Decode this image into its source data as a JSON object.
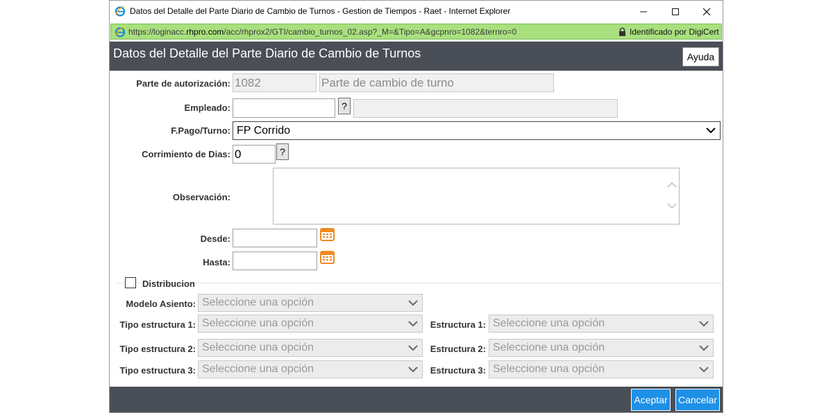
{
  "browser": {
    "window_title": "Datos del Detalle del Parte Diario de Cambio de Turnos - Gestion de Tiempos - Raet - Internet Explorer",
    "minimize_glyph": "—",
    "maximize_glyph": "☐",
    "close_glyph": "✕",
    "url_prefix": "https://loginacc.",
    "url_domain": "rhpro.com",
    "url_path": "/acc/rhprox2/GTI/cambio_turnos_02.asp?_M=&Tipo=A&gcpnro=1082&ternro=0",
    "security_text": "Identificado por DigiCert",
    "address_bar_color": "#a9e07f"
  },
  "header": {
    "title": "Datos del Detalle del Parte Diario de Cambio de Turnos",
    "help_label": "Ayuda",
    "background_color": "#4a4e57"
  },
  "form": {
    "parte_label": "Parte de autorización:",
    "parte_number": "1082",
    "parte_description": "Parte de cambio de turno",
    "empleado_label": "Empleado:",
    "empleado_value": "",
    "empleado_name": "",
    "help_glyph": "?",
    "fpago_label": "F.Pago/Turno:",
    "fpago_value": "FP Corrido",
    "corrimiento_label": "Corrimiento de Dias:",
    "corrimiento_value": "0",
    "observacion_label": "Observación:",
    "desde_label": "Desde:",
    "desde_value": "",
    "hasta_label": "Hasta:",
    "hasta_value": ""
  },
  "distribucion": {
    "checkbox_label": "Distribucion",
    "checked": false,
    "modelo_label": "Modelo Asiento:",
    "modelo_value": "Seleccione una opción",
    "tipo1_label": "Tipo estructura 1:",
    "tipo1_value": "Seleccione una opción",
    "estr1_label": "Estructura 1:",
    "estr1_value": "Seleccione una opción",
    "tipo2_label": "Tipo estructura 2:",
    "tipo2_value": "Seleccione una opción",
    "estr2_label": "Estructura 2:",
    "estr2_value": "Seleccione una opción",
    "tipo3_label": "Tipo estructura 3:",
    "tipo3_value": "Seleccione una opción",
    "estr3_label": "Estructura 3:",
    "estr3_value": "Seleccione una opción"
  },
  "footer": {
    "accept_label": "Aceptar",
    "cancel_label": "Cancelar",
    "button_color": "#1e90e6"
  },
  "icons": [
    "ie-logo-icon",
    "lock-icon",
    "calendar-icon",
    "chevron-down-icon",
    "chevron-up-icon",
    "minimize-icon",
    "maximize-icon",
    "close-icon"
  ]
}
